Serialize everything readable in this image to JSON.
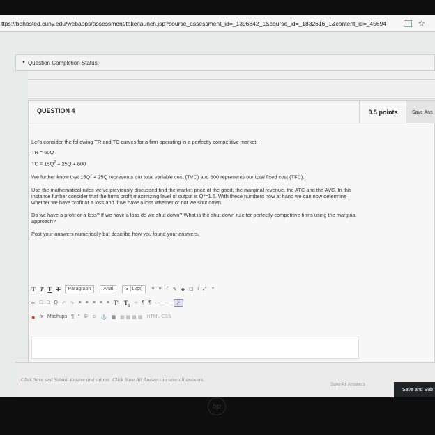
{
  "browser": {
    "tab_label": "x",
    "url": "ttps://bbhosted.cuny.edu/webapps/assessment/take/launch.jsp?course_assessment_id=_1396842_1&course_id=_1832616_1&content_id=_45694",
    "star_icon": "☆"
  },
  "status": {
    "label": "Question Completion Status:"
  },
  "question": {
    "title": "QUESTION 4",
    "points": "0.5 points",
    "save_label": "Save Ans",
    "intro": "Let's consider the following TR and TC curves for a firm operating in a perfectly competitive market:",
    "tr": "TR = 60Q",
    "tc_prefix": "TC = 15Q",
    "tc_exp": "2",
    "tc_suffix": " + 25Q + 600",
    "p2_prefix": "We further know that 15Q",
    "p2_exp": "2",
    "p2_suffix": " + 25Q represents our total variable cost (TVC) and 600 represents our total fixed cost (TFC).",
    "p3": "Use the mathematical rules we've previously discussed find the market price of the good, the marginal revenue, the ATC and the AVC. In this instance further consider that the firms profit maximizing level of output is Q*=1.5. With these numbers now at hand we can now determine whether we have profit or a loss and if we have a loss whether or not we shut down.",
    "p4": "Do we have a profit or a loss? If we have a loss do we shut down? What is the shut down rule for perfectly competitive firms using the marginal approach?",
    "p5": "Post your answers numerically but describe how you found your answers."
  },
  "editor": {
    "format_select": "Paragraph",
    "font_select": "Arial",
    "size_select": "3 (12pt)",
    "mashups_label": "Mashups",
    "html_css_label": "HTML CSS"
  },
  "footer": {
    "note": "Click Save and Submit to save and submit. Click Save All Answers to save all answers.",
    "save_all": "Save All Answers",
    "save_submit": "Save and Sub"
  }
}
